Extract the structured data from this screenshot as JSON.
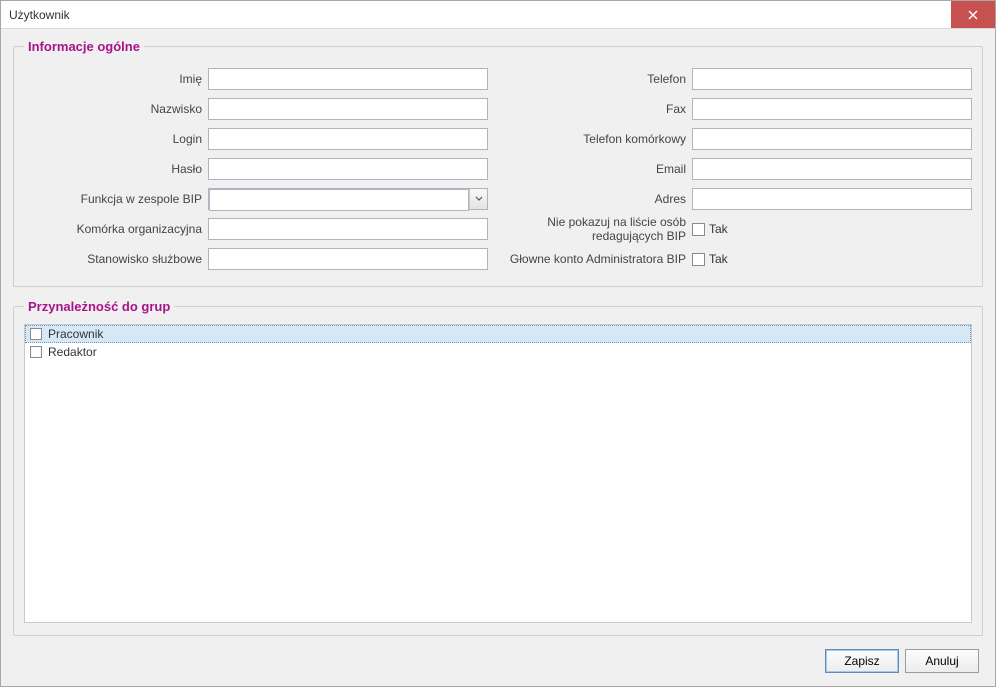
{
  "window": {
    "title": "Użytkownik"
  },
  "section_general": {
    "legend": "Informacje ogólne",
    "left": {
      "imie": {
        "label": "Imię",
        "value": ""
      },
      "nazwisko": {
        "label": "Nazwisko",
        "value": ""
      },
      "login": {
        "label": "Login",
        "value": ""
      },
      "haslo": {
        "label": "Hasło",
        "value": ""
      },
      "funkcja": {
        "label": "Funkcja w zespole BIP",
        "value": ""
      },
      "komorka": {
        "label": "Komórka organizacyjna",
        "value": ""
      },
      "stanowisko": {
        "label": "Stanowisko służbowe",
        "value": ""
      }
    },
    "right": {
      "telefon": {
        "label": "Telefon",
        "value": ""
      },
      "fax": {
        "label": "Fax",
        "value": ""
      },
      "tel_kom": {
        "label": "Telefon komórkowy",
        "value": ""
      },
      "email": {
        "label": "Email",
        "value": ""
      },
      "adres": {
        "label": "Adres",
        "value": ""
      },
      "nie_pokazuj": {
        "label": "Nie pokazuj na liście osób redagujących BIP",
        "yes_text": "Tak",
        "checked": false
      },
      "glowne_konto": {
        "label": "Głowne konto Administratora BIP",
        "yes_text": "Tak",
        "checked": false
      }
    }
  },
  "section_groups": {
    "legend": "Przynależność do grup",
    "items": [
      {
        "label": "Pracownik",
        "checked": false,
        "selected": true
      },
      {
        "label": "Redaktor",
        "checked": false,
        "selected": false
      }
    ]
  },
  "footer": {
    "save": "Zapisz",
    "cancel": "Anuluj"
  }
}
